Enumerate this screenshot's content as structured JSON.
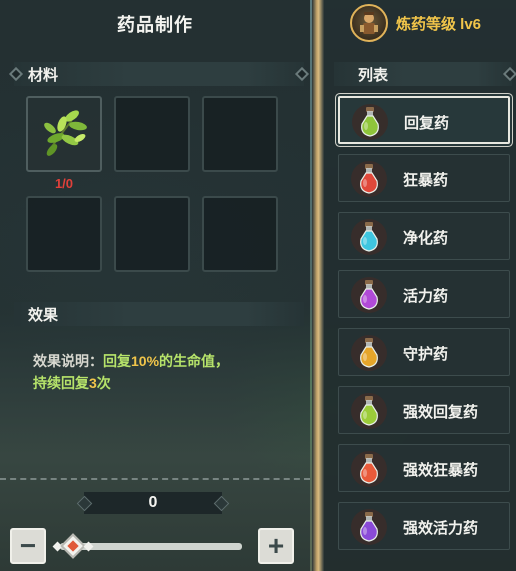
{
  "left_panel": {
    "title": "药品制作",
    "materials_header": "材料",
    "material_slots": [
      {
        "icon": "herb-leaves-icon",
        "count": "1/0"
      },
      {
        "icon": ""
      },
      {
        "icon": ""
      },
      {
        "icon": ""
      },
      {
        "icon": ""
      },
      {
        "icon": ""
      }
    ],
    "effect_header": "效果",
    "effect": {
      "label": "效果说明：",
      "text_part1": "回复",
      "highlight": "10%",
      "text_part2": "的生命值，",
      "line2_part1": "持续回复",
      "line2_highlight": "3",
      "line2_part2": "次"
    },
    "quantity": "0",
    "minus_label": "−",
    "plus_label": "+"
  },
  "right_panel": {
    "level_text": "炼药等级 lv6",
    "list_header": "列表",
    "items": [
      {
        "name": "回复药",
        "potion_color": "#8fc43a",
        "selected": true
      },
      {
        "name": "狂暴药",
        "potion_color": "#e0483a"
      },
      {
        "name": "净化药",
        "potion_color": "#3fc6e0"
      },
      {
        "name": "活力药",
        "potion_color": "#b14ad8"
      },
      {
        "name": "守护药",
        "potion_color": "#e6a52a"
      },
      {
        "name": "强效回复药",
        "potion_color": "#9ccc3a"
      },
      {
        "name": "强效狂暴药",
        "potion_color": "#e85a3a"
      },
      {
        "name": "强效活力药",
        "potion_color": "#8a4ad8"
      }
    ]
  },
  "colors": {
    "accent_gold": "#f1c54a",
    "effect_green": "#b6e36a",
    "count_red": "#e0403a"
  }
}
